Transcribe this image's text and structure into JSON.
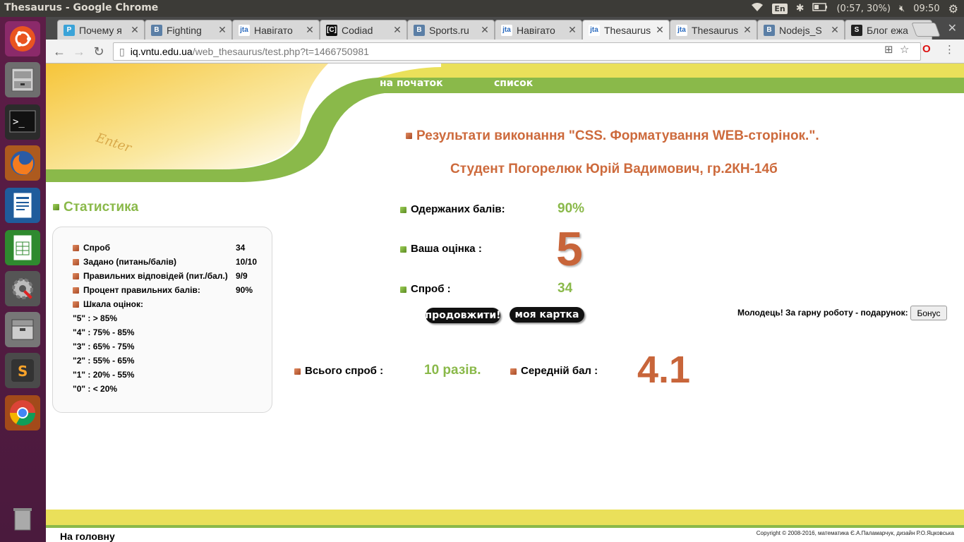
{
  "system": {
    "window_title": "Thesaurus - Google Chrome",
    "keyboard": "En",
    "battery": "(0:57, 30%)",
    "clock": "09:50"
  },
  "tabs": [
    {
      "label": "Почему я",
      "favicon": "P",
      "color": "#3aa3d8"
    },
    {
      "label": "Fighting",
      "favicon": "B",
      "color": "#5b7fa6"
    },
    {
      "label": "Навігато",
      "favicon": "jta",
      "color": "#ffffff"
    },
    {
      "label": "Codiad",
      "favicon": "[C]",
      "color": "#111111"
    },
    {
      "label": "Sports.ru",
      "favicon": "B",
      "color": "#5b7fa6"
    },
    {
      "label": "Навігато",
      "favicon": "jta",
      "color": "#ffffff"
    },
    {
      "label": "Thesaurus",
      "favicon": "jta",
      "color": "#ffffff"
    },
    {
      "label": "Thesaurus",
      "favicon": "jta",
      "color": "#ffffff"
    },
    {
      "label": "Nodejs_S",
      "favicon": "B",
      "color": "#5b7fa6"
    },
    {
      "label": "Блог ежа",
      "favicon": "S",
      "color": "#222222"
    }
  ],
  "address": {
    "host": "iq.vntu.edu.ua",
    "path": "/web_thesaurus/test.php?t=1466750981"
  },
  "nav": {
    "home": "на початок",
    "list": "список"
  },
  "result": {
    "title": "Результати виконання \"CSS. Форматування WEB-сторінок.\".",
    "student": "Студент Погорелюк Юрій Вадимович, гр.2КН-14б",
    "points_label": "Одержаних балів:",
    "points_value": "90%",
    "grade_label": "Ваша оцінка :",
    "grade_value": "5",
    "attempts_label": "Спроб :",
    "attempts_value": "34",
    "continue_btn": "продовжити!",
    "card_btn": "моя картка",
    "bonus_text": "Молодець! За гарну роботу - подарунок:",
    "bonus_btn": "Бонус",
    "total_label": "Всього спроб :",
    "total_value": "10 разів.",
    "avg_label": "Середній бал :",
    "avg_value": "4.1"
  },
  "stats": {
    "title": "Статистика",
    "rows": [
      {
        "label": "Спроб",
        "value": "34"
      },
      {
        "label": "Задано (питань/балів)",
        "value": "10/10"
      },
      {
        "label": "Правильних відповідей (пит./бал.)",
        "value": "9/9"
      },
      {
        "label": "Процент правильних балів:",
        "value": "90%"
      },
      {
        "label": "Шкала оцінок:",
        "value": ""
      }
    ],
    "scale": [
      "\"5\" : > 85%",
      "\"4\" : 75% - 85%",
      "\"3\" : 65% - 75%",
      "\"2\" : 55% - 65%",
      "\"1\" : 20% - 55%",
      "\"0\" : < 20%"
    ]
  },
  "footer": {
    "home": "На головну",
    "copyright": "Copyright © 2008-2016, математика Є.А.Паламарчук, дизайн Р.О.Яцковська"
  },
  "colors": {
    "accent_orange": "#cd6a3c",
    "accent_green": "#8ab94a",
    "footer_yellow": "#eae05a"
  }
}
